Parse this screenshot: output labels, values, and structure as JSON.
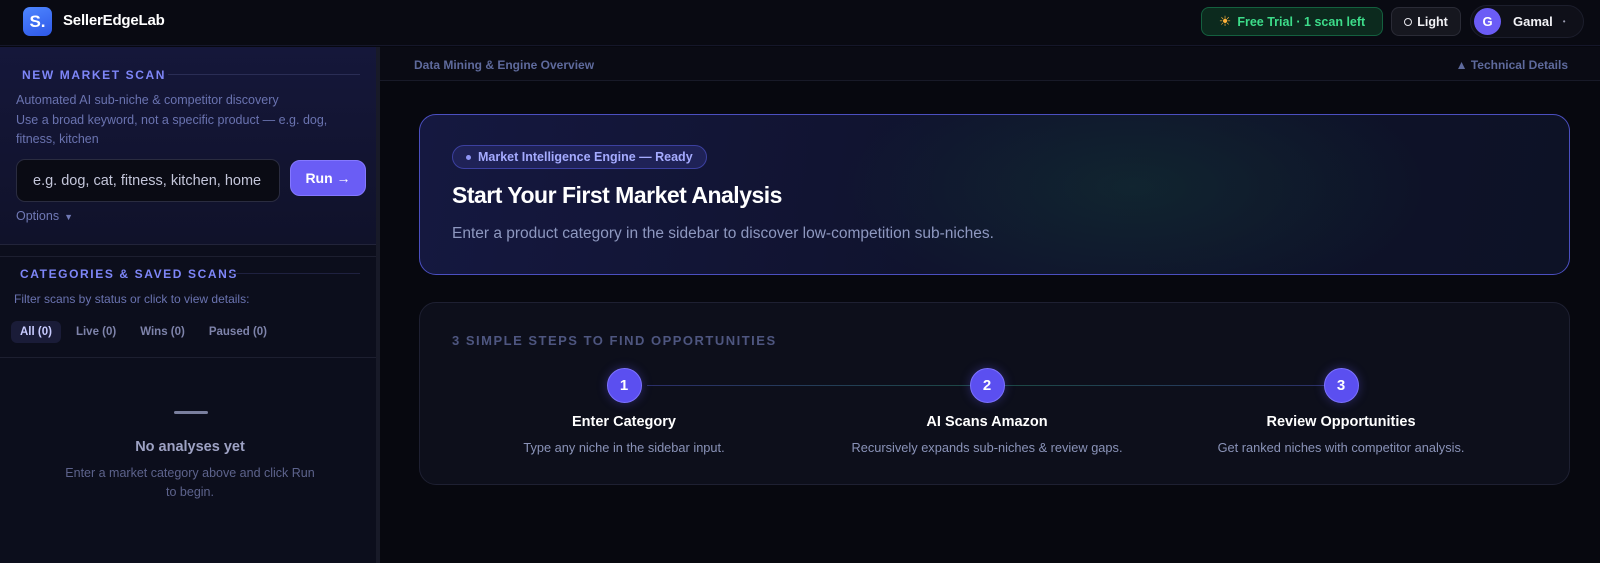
{
  "topbar": {
    "logo_glyph": "S.",
    "brand": "SellerEdgeLab",
    "trial_label": "Free Trial · 1 scan left",
    "theme_label": "Light",
    "user_initial": "G",
    "user_name": "Gamal"
  },
  "sidebar": {
    "scan_title": "NEW MARKET SCAN",
    "scan_subtitle": "Automated AI sub-niche & competitor discovery",
    "scan_hint": "Use a broad keyword, not a specific product — e.g. dog, fitness, kitchen",
    "search_placeholder": "e.g. dog, cat, fitness, kitchen, home",
    "run_label": "Run →",
    "options_label": "Options",
    "categories_title": "CATEGORIES & SAVED SCANS",
    "categories_hint": "Filter scans by status or click to view details:",
    "tabs": [
      {
        "label": "All (0)",
        "active": true
      },
      {
        "label": "Live (0)",
        "active": false
      },
      {
        "label": "Wins (0)",
        "active": false
      },
      {
        "label": "Paused (0)",
        "active": false
      }
    ],
    "empty_title": "No analyses yet",
    "empty_sub": "Enter a market category above and click Run to begin."
  },
  "main": {
    "breadcrumb": "Data Mining & Engine Overview",
    "technical_details": "▲ Technical Details",
    "hero": {
      "badge": "Market Intelligence Engine — Ready",
      "title": "Start Your First Market Analysis",
      "subtitle": "Enter a product category in the sidebar to discover low-competition sub-niches."
    },
    "steps": {
      "title": "3 SIMPLE STEPS TO FIND OPPORTUNITIES",
      "items": [
        {
          "num": "1",
          "title": "Enter Category",
          "desc": "Type any niche in the sidebar input."
        },
        {
          "num": "2",
          "title": "AI Scans Amazon",
          "desc": "Recursively expands sub-niches & review gaps."
        },
        {
          "num": "3",
          "title": "Review Opportunities",
          "desc": "Get ranked niches with competitor analysis."
        }
      ]
    }
  },
  "colors": {
    "accent": "#6a5df5",
    "trial_green": "#3ddc8a",
    "background": "#07080f"
  }
}
